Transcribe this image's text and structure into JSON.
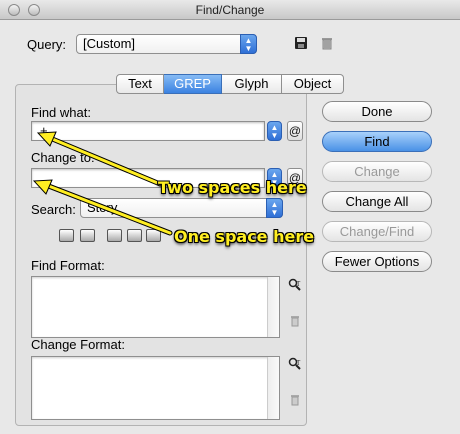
{
  "window": {
    "title": "Find/Change"
  },
  "query": {
    "label": "Query:",
    "value": "[Custom]"
  },
  "tabs": [
    {
      "label": "Text"
    },
    {
      "label": "GREP"
    },
    {
      "label": "Glyph"
    },
    {
      "label": "Object"
    }
  ],
  "find_what": {
    "label": "Find what:",
    "value": "+"
  },
  "change_to": {
    "label": "Change to:",
    "value": ""
  },
  "search": {
    "label": "Search:",
    "value": "Story"
  },
  "find_format": {
    "label": "Find Format:"
  },
  "change_format": {
    "label": "Change Format:"
  },
  "buttons": {
    "done": "Done",
    "find": "Find",
    "change": "Change",
    "change_all": "Change All",
    "change_find": "Change/Find",
    "fewer_options": "Fewer Options"
  },
  "annotations": {
    "two_spaces": "Two spaces here",
    "one_space": "One space here",
    "color": "#ffee22"
  },
  "special_char_symbol": "@"
}
